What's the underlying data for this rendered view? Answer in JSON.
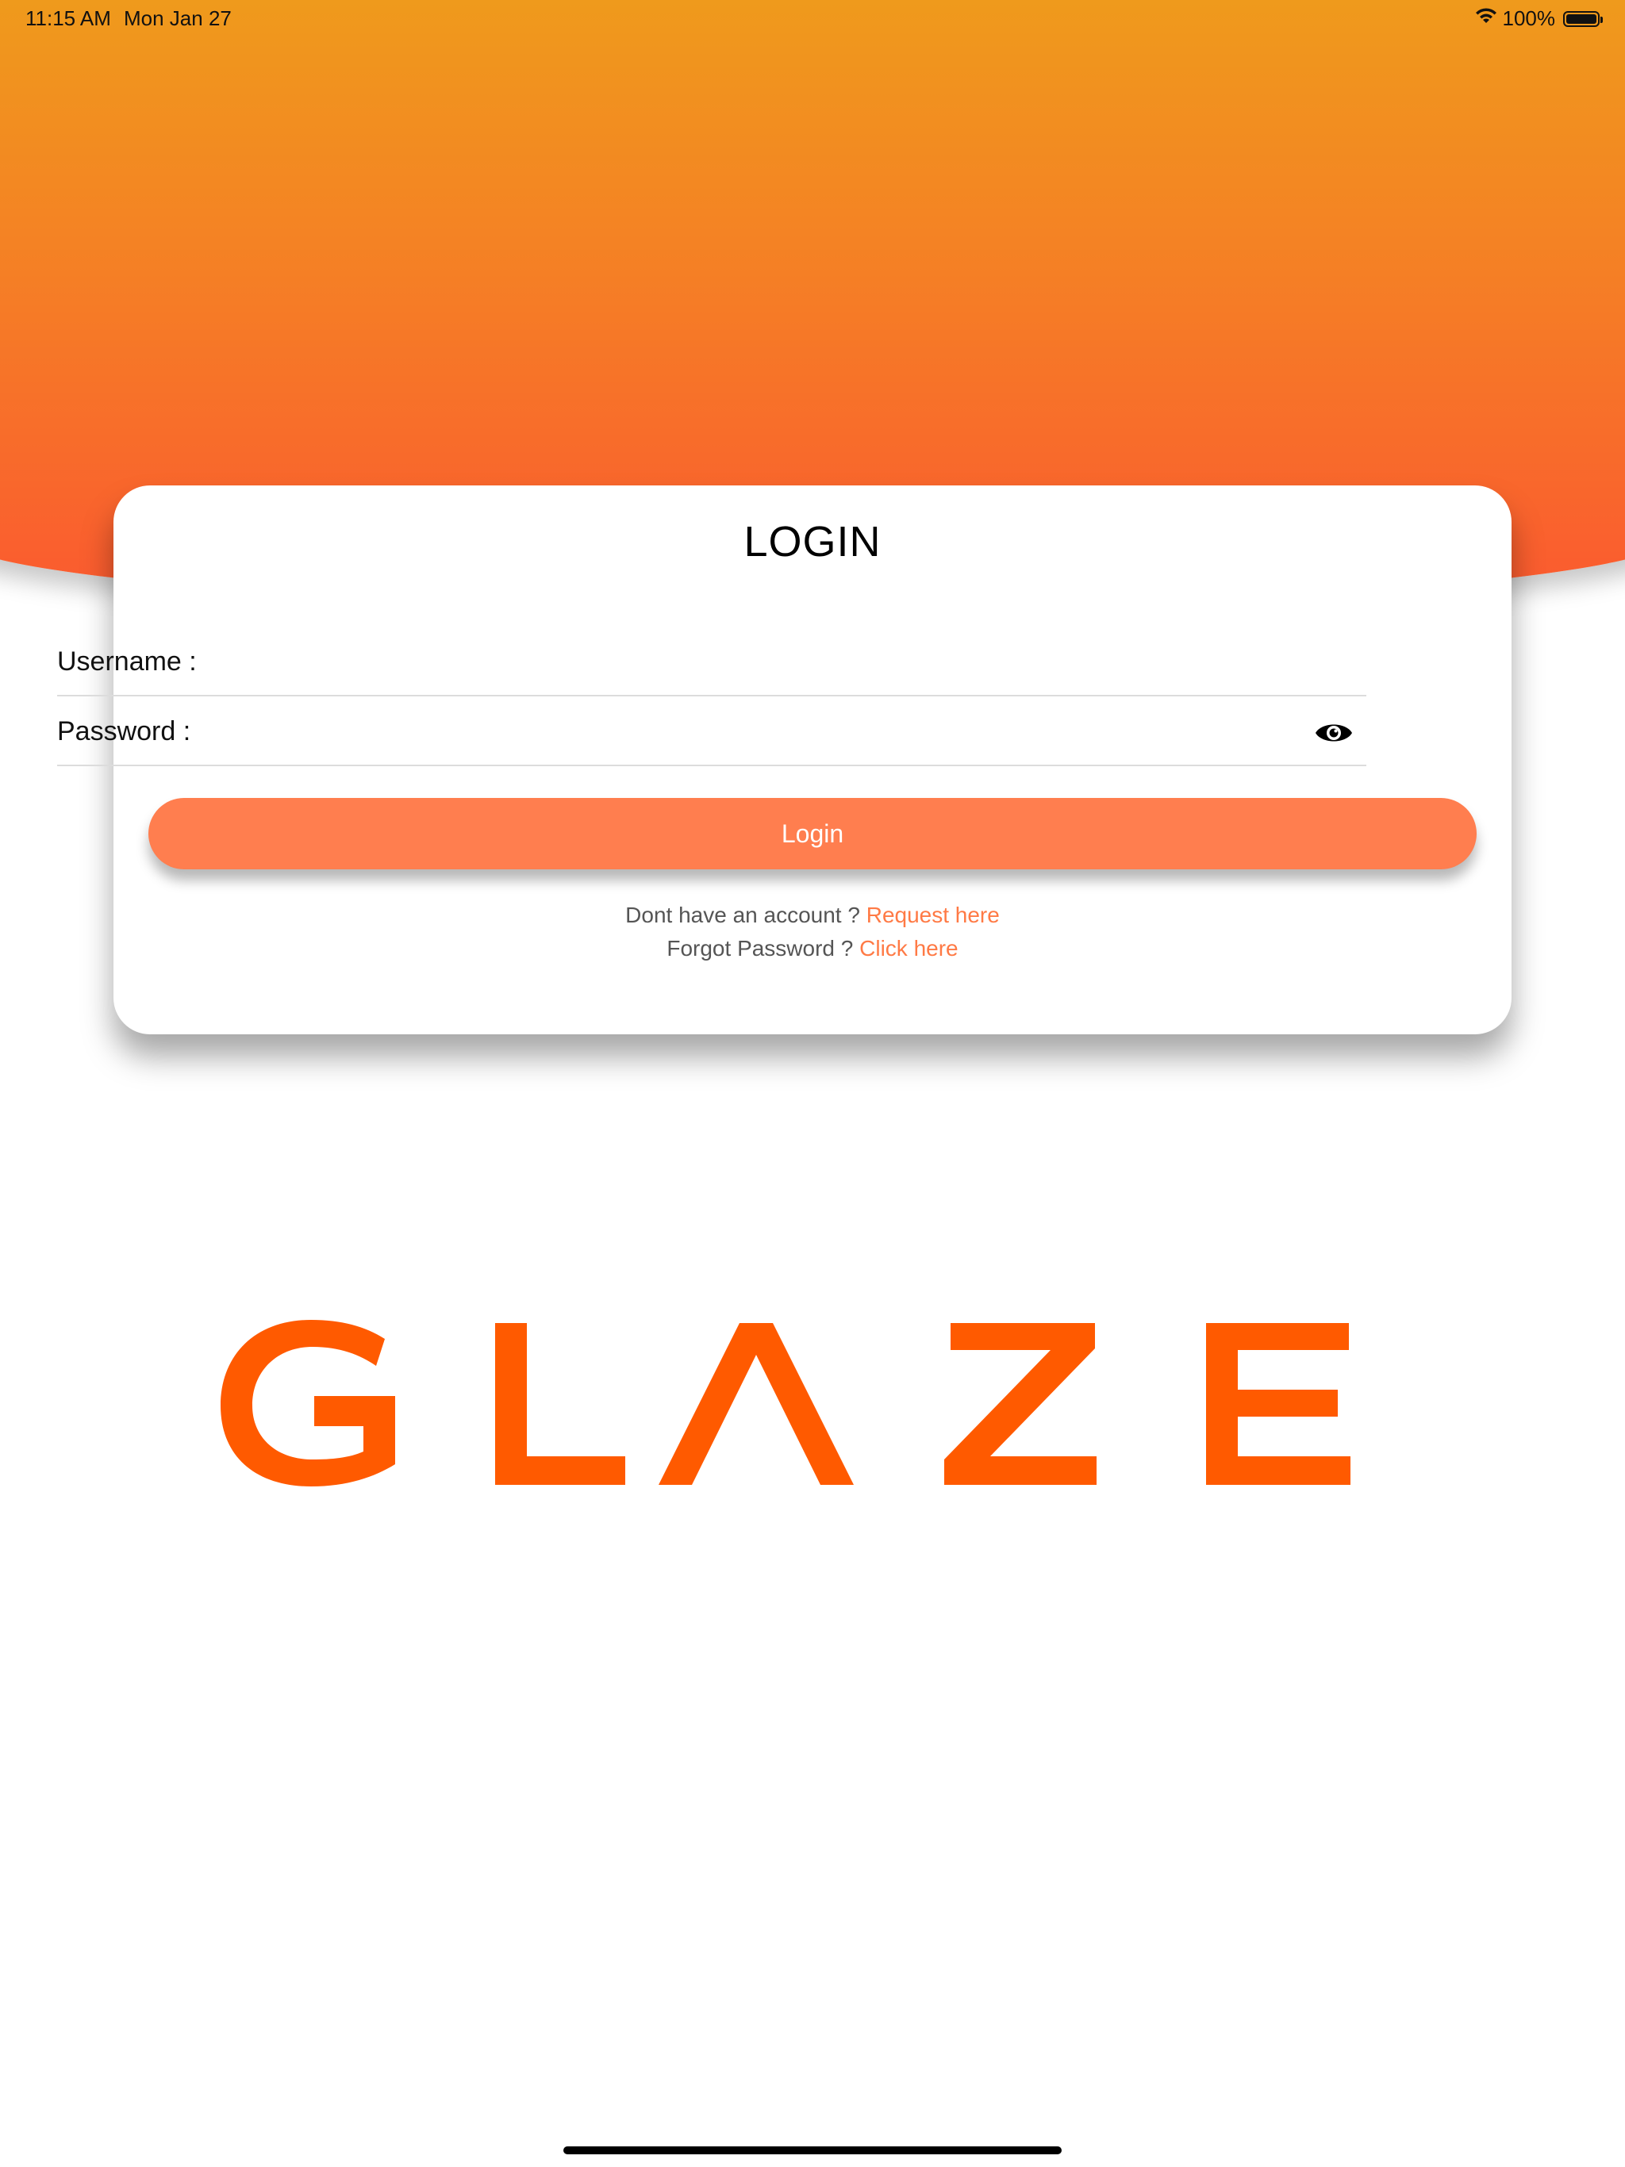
{
  "status_bar": {
    "time": "11:15 AM",
    "date": "Mon Jan 27",
    "battery": "100%",
    "icons": [
      "wifi-icon",
      "battery-icon"
    ]
  },
  "login_card": {
    "title": "LOGIN",
    "username_label": "Username :",
    "username_value": "",
    "password_label": "Password :",
    "password_value": "",
    "password_toggle_icon": "eye-icon",
    "login_button": "Login",
    "no_account_text": "Dont have an account ?",
    "request_link": "Request here",
    "forgot_text": "Forgot Password ?",
    "forgot_link": "Click here"
  },
  "logo": {
    "text": "GLAZE"
  },
  "colors": {
    "header_gradient_top": "#ef9a1c",
    "header_gradient_bottom": "#fb5930",
    "accent": "#ff7e4f",
    "link": "#ff7a45",
    "logo": "#ff5a00"
  }
}
